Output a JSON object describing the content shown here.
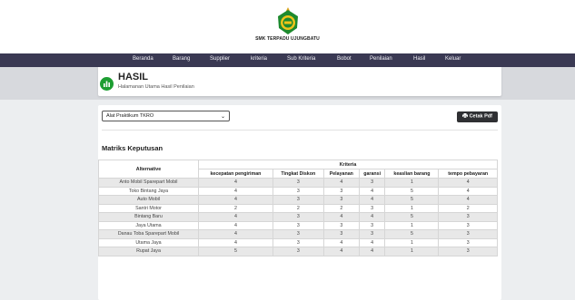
{
  "header": {
    "school_name": "SMK TERPADU UJUNGBATU"
  },
  "nav": {
    "items": [
      "Beranda",
      "Barang",
      "Supplier",
      "kriteria",
      "Sub Kriteria",
      "Bobot",
      "Penilaian",
      "Hasil",
      "Keluar"
    ]
  },
  "page": {
    "title": "HASIL",
    "subtitle": "Halamanan Utama Hasil Penilaian"
  },
  "filter": {
    "selected": "Alat Praktikum TKRO"
  },
  "print_button": {
    "label": "Cetak Pdf"
  },
  "matrix": {
    "title": "Matriks Keputusan",
    "alt_header": "Alternative",
    "group_header": "Kriteria",
    "criteria": [
      "kecepatan pengiriman",
      "Tingkat Diskon",
      "Pelayanan",
      "garansi",
      "keaslian barang",
      "tempo pebayaran"
    ],
    "rows": [
      {
        "name": "Anto Mobil Sparepart Mobil",
        "values": [
          "4",
          "3",
          "4",
          "3",
          "1",
          "4"
        ]
      },
      {
        "name": "Toko Bintang Jaya",
        "values": [
          "4",
          "3",
          "3",
          "4",
          "5",
          "4"
        ]
      },
      {
        "name": "Auto Mobil",
        "values": [
          "4",
          "3",
          "3",
          "4",
          "5",
          "4"
        ]
      },
      {
        "name": "Santri Motor",
        "values": [
          "2",
          "2",
          "2",
          "3",
          "1",
          "2"
        ]
      },
      {
        "name": "Bintang Baru",
        "values": [
          "4",
          "3",
          "4",
          "4",
          "5",
          "3"
        ]
      },
      {
        "name": "Jaya Utama",
        "values": [
          "4",
          "3",
          "3",
          "3",
          "1",
          "3"
        ]
      },
      {
        "name": "Danau Toba Sparepart Mobil",
        "values": [
          "4",
          "3",
          "3",
          "3",
          "5",
          "3"
        ]
      },
      {
        "name": "Utama Jaya",
        "values": [
          "4",
          "3",
          "4",
          "4",
          "1",
          "3"
        ]
      },
      {
        "name": "Rupat Jaya",
        "values": [
          "5",
          "3",
          "4",
          "4",
          "1",
          "3"
        ]
      }
    ]
  },
  "colors": {
    "navbar": "#3a3953",
    "accent_green": "#1e9e32",
    "button_dark": "#2f3033"
  },
  "icons": {
    "logo": "school-emblem",
    "hero": "bar-chart-icon",
    "print": "printer-icon",
    "select": "chevron-down-icon"
  }
}
